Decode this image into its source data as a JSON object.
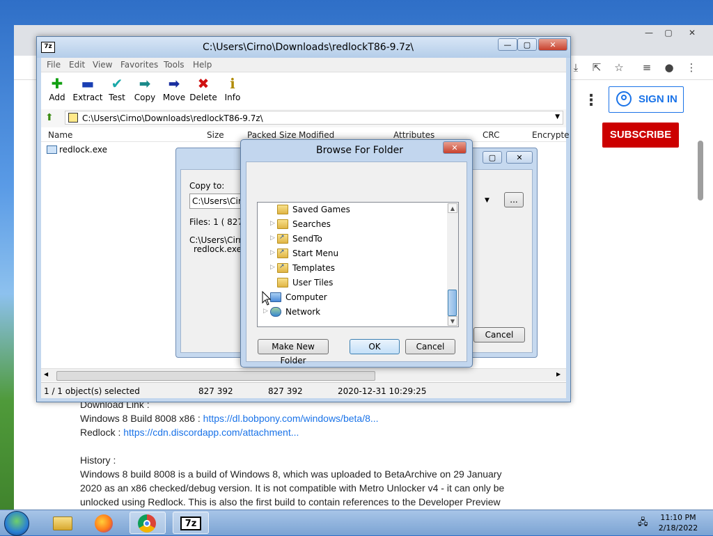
{
  "zip": {
    "title": "C:\\Users\\Cirno\\Downloads\\redlockT86-9.7z\\",
    "menu": [
      "File",
      "Edit",
      "View",
      "Favorites",
      "Tools",
      "Help"
    ],
    "tools": [
      {
        "label": "Add",
        "icon": "plus-icon",
        "glyph": "✚",
        "color": "#12a012"
      },
      {
        "label": "Extract",
        "icon": "minus-icon",
        "glyph": "▬",
        "color": "#1a3fb3"
      },
      {
        "label": "Test",
        "icon": "check-icon",
        "glyph": "✔",
        "color": "#1aa8a8"
      },
      {
        "label": "Copy",
        "icon": "arrow-right-icon",
        "glyph": "➡",
        "color": "#1a8a8a"
      },
      {
        "label": "Move",
        "icon": "arrow-right-icon",
        "glyph": "➡",
        "color": "#1a2fa0"
      },
      {
        "label": "Delete",
        "icon": "x-icon",
        "glyph": "✖",
        "color": "#d01010"
      },
      {
        "label": "Info",
        "icon": "info-icon",
        "glyph": "ℹ",
        "color": "#b08a00"
      }
    ],
    "address": "C:\\Users\\Cirno\\Downloads\\redlockT86-9.7z\\",
    "columns": [
      "Name",
      "Size",
      "Packed Size",
      "Modified",
      "Attributes",
      "CRC",
      "Encrypte"
    ],
    "file": {
      "name": "redlock.exe"
    },
    "status": {
      "selection": "1 / 1 object(s) selected",
      "size": "827 392",
      "packed": "827 392",
      "modified": "2020-12-31 10:29:25"
    }
  },
  "copy_dialog": {
    "copy_to_label": "Copy to:",
    "path_value": "C:\\Users\\Cirno",
    "files_label": "Files: 1    ( 827",
    "path_line": "C:\\Users\\Cirno\\",
    "file_line": "redlock.exe",
    "browse_label": "...",
    "cancel_label": "Cancel"
  },
  "browse": {
    "title": "Browse For Folder",
    "tree": [
      {
        "label": "Saved Games",
        "indent": 1,
        "expandable": false,
        "icon": "folder-icon",
        "kind": "fold"
      },
      {
        "label": "Searches",
        "indent": 1,
        "expandable": true,
        "icon": "folder-icon",
        "kind": "fold"
      },
      {
        "label": "SendTo",
        "indent": 1,
        "expandable": true,
        "icon": "shortcut-folder-icon",
        "kind": "lnk"
      },
      {
        "label": "Start Menu",
        "indent": 1,
        "expandable": true,
        "icon": "shortcut-folder-icon",
        "kind": "lnk"
      },
      {
        "label": "Templates",
        "indent": 1,
        "expandable": true,
        "icon": "shortcut-folder-icon",
        "kind": "lnk"
      },
      {
        "label": "User Tiles",
        "indent": 1,
        "expandable": false,
        "icon": "folder-icon",
        "kind": "fold"
      },
      {
        "label": "Computer",
        "indent": 0,
        "expandable": true,
        "icon": "computer-icon",
        "kind": "pc"
      },
      {
        "label": "Network",
        "indent": 0,
        "expandable": true,
        "icon": "network-icon",
        "kind": "net"
      }
    ],
    "new_folder_label": "Make New Folder",
    "ok_label": "OK",
    "cancel_label": "Cancel"
  },
  "web": {
    "sign_in": "SIGN IN",
    "subscribe": "SUBSCRIBE",
    "download_link_label": "Download Link :",
    "line1_text": "Windows 8 Build 8008 x86 : ",
    "line1_link": "https://dl.bobpony.com/windows/beta/8...",
    "line2_text": "Redlock : ",
    "line2_link": "https://cdn.discordapp.com/attachment...",
    "history_label": "History :",
    "history_lines": [
      "Windows 8 build 8008 is a build of Windows 8, which was uploaded to BetaArchive on 29 January",
      "2020 as an x86 checked/debug version. It is not compatible with Metro Unlocker v4 - it can only be",
      "unlocked using Redlock. This is also the first build to contain references to the Developer Preview"
    ]
  },
  "taskbar": {
    "time": "11:10 PM",
    "date": "2/18/2022"
  }
}
